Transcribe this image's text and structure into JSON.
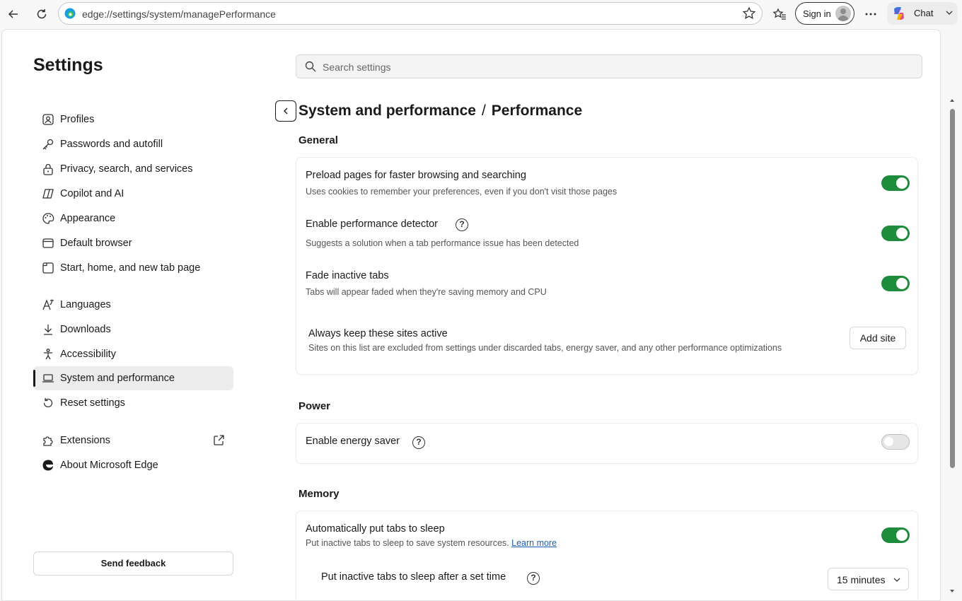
{
  "browser": {
    "url": "edge://settings/system/managePerformance",
    "sign_in": "Sign in",
    "chat": "Chat"
  },
  "settings": {
    "title": "Settings",
    "search_placeholder": "Search settings"
  },
  "sidebar": {
    "items": [
      {
        "label": "Profiles",
        "icon": "profile-icon"
      },
      {
        "label": "Passwords and autofill",
        "icon": "key-icon"
      },
      {
        "label": "Privacy, search, and services",
        "icon": "lock-icon"
      },
      {
        "label": "Copilot and AI",
        "icon": "copilot-icon"
      },
      {
        "label": "Appearance",
        "icon": "palette-icon"
      },
      {
        "label": "Default browser",
        "icon": "browser-icon"
      },
      {
        "label": "Start, home, and new tab page",
        "icon": "home-icon"
      },
      {
        "label": "Languages",
        "icon": "language-icon"
      },
      {
        "label": "Downloads",
        "icon": "download-icon"
      },
      {
        "label": "Accessibility",
        "icon": "accessibility-icon"
      },
      {
        "label": "System and performance",
        "icon": "laptop-icon",
        "active": true
      },
      {
        "label": "Reset settings",
        "icon": "reset-icon"
      },
      {
        "label": "Extensions",
        "icon": "puzzle-icon"
      },
      {
        "label": "About Microsoft Edge",
        "icon": "edge-icon"
      }
    ],
    "feedback": "Send feedback"
  },
  "breadcrumb": {
    "parent": "System and performance",
    "separator": "/",
    "current": "Performance"
  },
  "general": {
    "heading": "General",
    "preload": {
      "title": "Preload pages for faster browsing and searching",
      "desc": "Uses cookies to remember your preferences, even if you don't visit those pages",
      "on": true
    },
    "detector": {
      "title": "Enable performance detector",
      "desc": "Suggests a solution when a tab performance issue has been detected",
      "on": true
    },
    "fade": {
      "title": "Fade inactive tabs",
      "desc": "Tabs will appear faded when they're saving memory and CPU",
      "on": true
    },
    "keep_active": {
      "title": "Always keep these sites active",
      "desc": "Sites on this list are excluded from settings under discarded tabs, energy saver, and any other performance optimizations",
      "button": "Add site"
    }
  },
  "power": {
    "heading": "Power",
    "energy_saver": {
      "title": "Enable energy saver",
      "on": false
    }
  },
  "memory": {
    "heading": "Memory",
    "sleep": {
      "title": "Automatically put tabs to sleep",
      "desc": "Put inactive tabs to sleep to save system resources.",
      "link": "Learn more",
      "on": true
    },
    "sleep_after": {
      "title": "Put inactive tabs to sleep after a set time",
      "value": "15 minutes"
    }
  },
  "colors": {
    "toggle_on": "#1e8c3a",
    "link": "#1a5fb4"
  }
}
